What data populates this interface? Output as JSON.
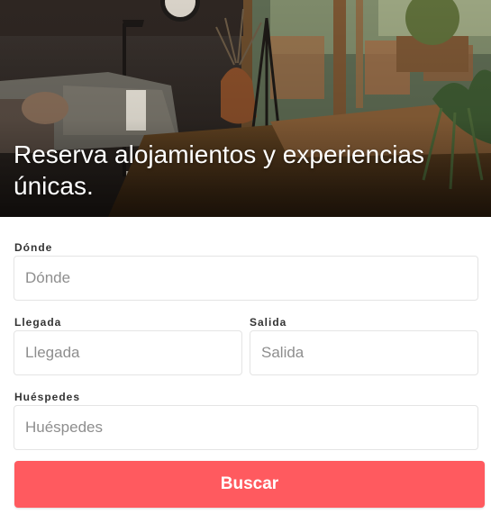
{
  "hero": {
    "title": "Reserva alojamientos y experiencias únicas."
  },
  "form": {
    "where": {
      "label": "Dónde",
      "placeholder": "Dónde"
    },
    "checkin": {
      "label": "Llegada",
      "placeholder": "Llegada"
    },
    "checkout": {
      "label": "Salida",
      "placeholder": "Salida"
    },
    "guests": {
      "label": "Huéspedes",
      "placeholder": "Huéspedes"
    },
    "submit_label": "Buscar"
  },
  "colors": {
    "accent": "#ff5a5f",
    "field_border": "#e4e4e4",
    "label_text": "#333333"
  }
}
